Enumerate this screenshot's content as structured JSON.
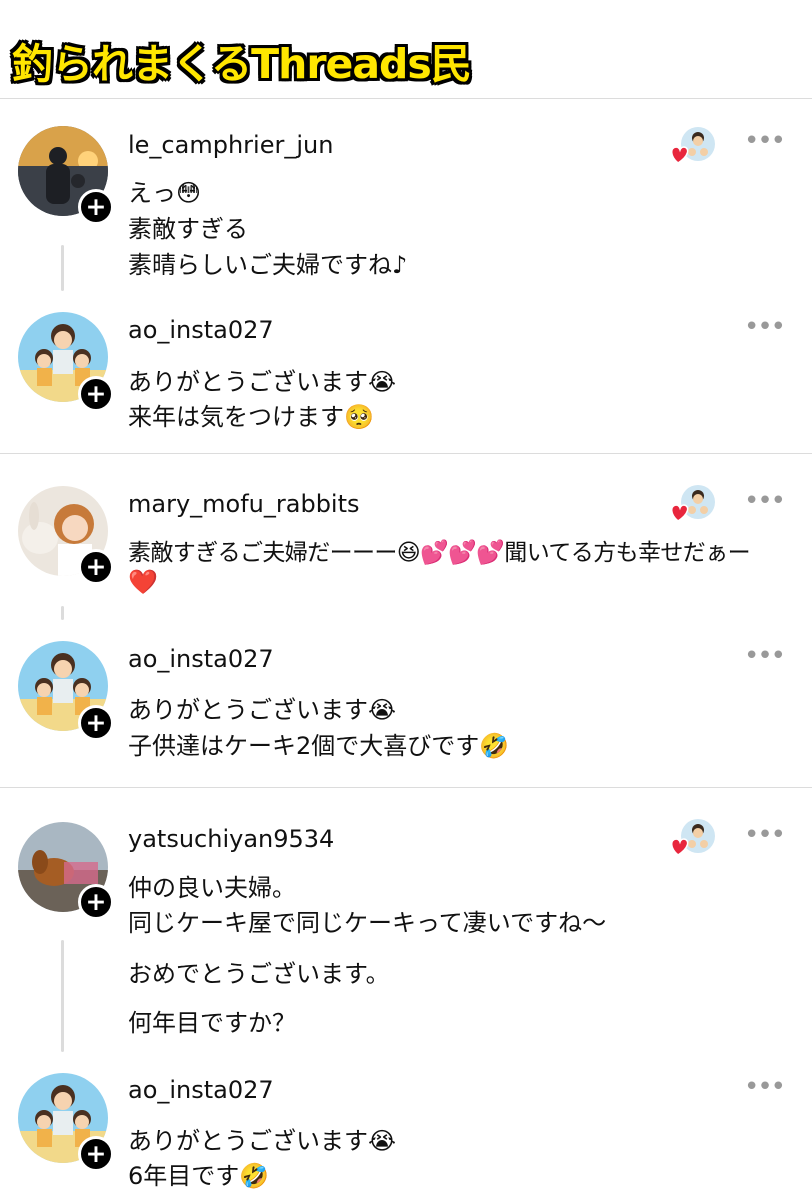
{
  "header": {
    "title": "釣られまくるThreads民"
  },
  "icons": {
    "more": "more-horizontal-icon",
    "follow": "plus-icon",
    "liked": "heart-icon"
  },
  "threads": [
    {
      "comment": {
        "username": "le_camphrier_jun",
        "lines": [
          "えっ😳",
          "素敵すぎる",
          "素晴らしいご夫婦ですね♪"
        ]
      },
      "reply": {
        "username": "ao_insta027",
        "lines": [
          "ありがとうございます😭",
          "来年は気をつけます🥺"
        ]
      }
    },
    {
      "comment": {
        "username": "mary_mofu_rabbits",
        "lines": [
          "素敵すぎるご夫婦だーーー😆💕💕💕聞いてる方も幸せだぁー",
          "❤️"
        ]
      },
      "reply": {
        "username": "ao_insta027",
        "lines": [
          "ありがとうございます😭",
          "子供達はケーキ2個で大喜びです🤣"
        ]
      }
    },
    {
      "comment": {
        "username": "yatsuchiyan9534",
        "lines": [
          "仲の良い夫婦。",
          "同じケーキ屋で同じケーキって凄いですね〜",
          "おめでとうございます。",
          "何年目ですか？"
        ]
      },
      "reply": {
        "username": "ao_insta027",
        "lines": [
          "ありがとうございます😭",
          "6年目です🤣"
        ]
      }
    }
  ],
  "colors": {
    "banner_text": "#ffe600",
    "banner_outline": "#000000",
    "heart": "#e8263d",
    "divider": "#dcdcdc"
  }
}
